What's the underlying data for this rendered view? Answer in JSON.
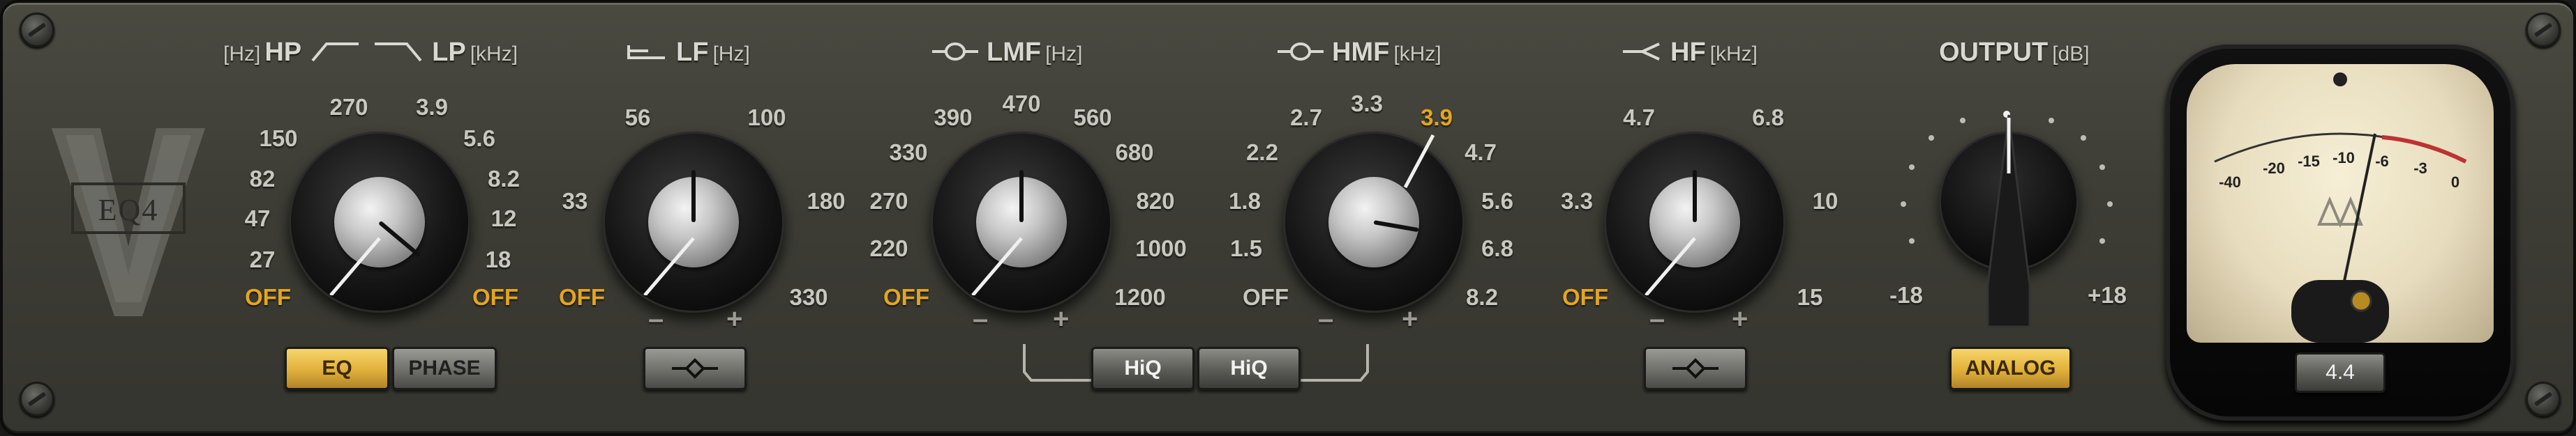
{
  "hp_lp": {
    "label_hp_unit": "[Hz]",
    "label_hp": "HP",
    "label_lp": "LP",
    "label_lp_unit": "[kHz]",
    "hp_scale": [
      "OFF",
      "27",
      "47",
      "82",
      "150",
      "270"
    ],
    "lp_scale": [
      "3.9",
      "5.6",
      "8.2",
      "12",
      "18",
      "OFF"
    ],
    "button_eq": "EQ",
    "button_phase": "PHASE"
  },
  "lf": {
    "label": "LF",
    "unit": "[Hz]",
    "scale": [
      "OFF",
      "33",
      "56",
      "100",
      "180",
      "330"
    ],
    "minus": "–",
    "plus": "+"
  },
  "lmf": {
    "label": "LMF",
    "unit": "[Hz]",
    "scale": [
      "OFF",
      "220",
      "270",
      "330",
      "390",
      "470",
      "560",
      "680",
      "820",
      "1000",
      "1200"
    ],
    "minus": "–",
    "plus": "+"
  },
  "hmf": {
    "label": "HMF",
    "unit": "[kHz]",
    "scale": [
      "OFF",
      "1.5",
      "1.8",
      "2.2",
      "2.7",
      "3.3",
      "3.9",
      "4.7",
      "5.6",
      "6.8",
      "8.2"
    ],
    "selected": "3.9",
    "minus": "–",
    "plus": "+"
  },
  "hiq": {
    "left_label": "HiQ",
    "right_label": "HiQ"
  },
  "hf": {
    "label": "HF",
    "unit": "[kHz]",
    "scale": [
      "OFF",
      "3.3",
      "4.7",
      "6.8",
      "10",
      "15"
    ],
    "minus": "–",
    "plus": "+"
  },
  "output": {
    "label": "OUTPUT",
    "unit": "[dB]",
    "min": "-18",
    "max": "+18",
    "button_analog": "ANALOG"
  },
  "meter": {
    "scale": [
      "-40",
      "-20",
      "-15",
      "-10",
      "-6",
      "-3",
      "0"
    ],
    "value_display": "4.4"
  },
  "logo": {
    "letter": "V",
    "text": "EQ4"
  },
  "colors": {
    "accent": "#e3a521",
    "panel": "#3d3d36",
    "text": "#d9d9d2"
  }
}
